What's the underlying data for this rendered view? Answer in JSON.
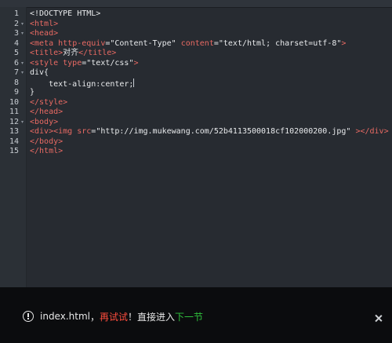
{
  "editor": {
    "line_numbers": [
      "1",
      "2",
      "3",
      "4",
      "5",
      "6",
      "7",
      "8",
      "9",
      "10",
      "11",
      "12",
      "13",
      "14",
      "15"
    ],
    "lines": {
      "l1": {
        "text": "<!DOCTYPE HTML>"
      },
      "l2": {
        "t1": "<html>"
      },
      "l3": {
        "t1": "<head>"
      },
      "l4": {
        "t1": "<meta",
        "a1": " http-equiv",
        "p1": "=",
        "s1": "\"Content-Type\"",
        "a2": " content",
        "p2": "=",
        "s2": "\"text/html; charset=utf-8\"",
        "t2": ">"
      },
      "l5": {
        "t1": "<title>",
        "p1": "对齐",
        "t2": "</title>"
      },
      "l6": {
        "t1": "<style",
        "a1": " type",
        "p1": "=",
        "s1": "\"text/css\"",
        "t2": ">"
      },
      "l7": {
        "p1": "div{"
      },
      "l8": {
        "p1": "    text-align:center;"
      },
      "l9": {
        "p1": "}"
      },
      "l10": {
        "t1": "</style>"
      },
      "l11": {
        "t1": "</head>"
      },
      "l12": {
        "t1": "<body>"
      },
      "l13": {
        "t1": "<div><img",
        "a1": " src",
        "p1": "=",
        "s1": "\"http://img.mukewang.com/52b4113500018cf102000200.jpg\"",
        "t2": " ></div>"
      },
      "l14": {
        "t1": "</body>"
      },
      "l15": {
        "t1": "</html>"
      }
    },
    "fold_marker": "▾",
    "fold_icon": "chevron-down-icon",
    "colors": {
      "background": "#272b31",
      "gutter": "#2b3036",
      "tag": "#e86a63",
      "text": "#e8eaec"
    }
  },
  "result_bar": {
    "info_icon": "info-circle-icon",
    "filename": "index.html",
    "comma": "，",
    "retry_label": "再试试",
    "exclaim": "！",
    "direct_text": "直接进入",
    "next_label": "下一节",
    "close_icon": "close-icon",
    "colors": {
      "background": "#0b0c0e",
      "retry": "#ff4d3d",
      "next": "#2fbf3c",
      "text": "#e6e6e6"
    }
  }
}
